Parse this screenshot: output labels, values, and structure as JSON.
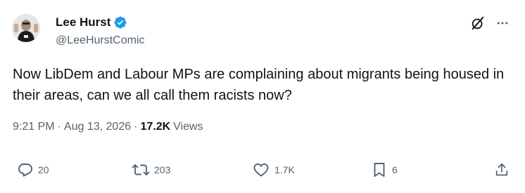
{
  "author": {
    "name": "Lee Hurst",
    "handle": "@LeeHurstComic",
    "verified": true
  },
  "tweet": {
    "text": "Now LibDem and Labour MPs are complaining about migrants being housed in their areas, can we all call them racists now?"
  },
  "meta": {
    "time": "9:21 PM",
    "separator": "·",
    "date": "Aug 13, 2026",
    "views_count": "17.2K",
    "views_label": "Views"
  },
  "actions": {
    "replies": "20",
    "reposts": "203",
    "likes": "1.7K",
    "bookmarks": "6"
  },
  "colors": {
    "text": "#0f1419",
    "secondary": "#536471",
    "verified": "#1d9bf0"
  },
  "icons": [
    "verified-badge-icon",
    "grok-icon",
    "more-icon",
    "reply-icon",
    "repost-icon",
    "like-icon",
    "bookmark-icon",
    "share-icon"
  ]
}
